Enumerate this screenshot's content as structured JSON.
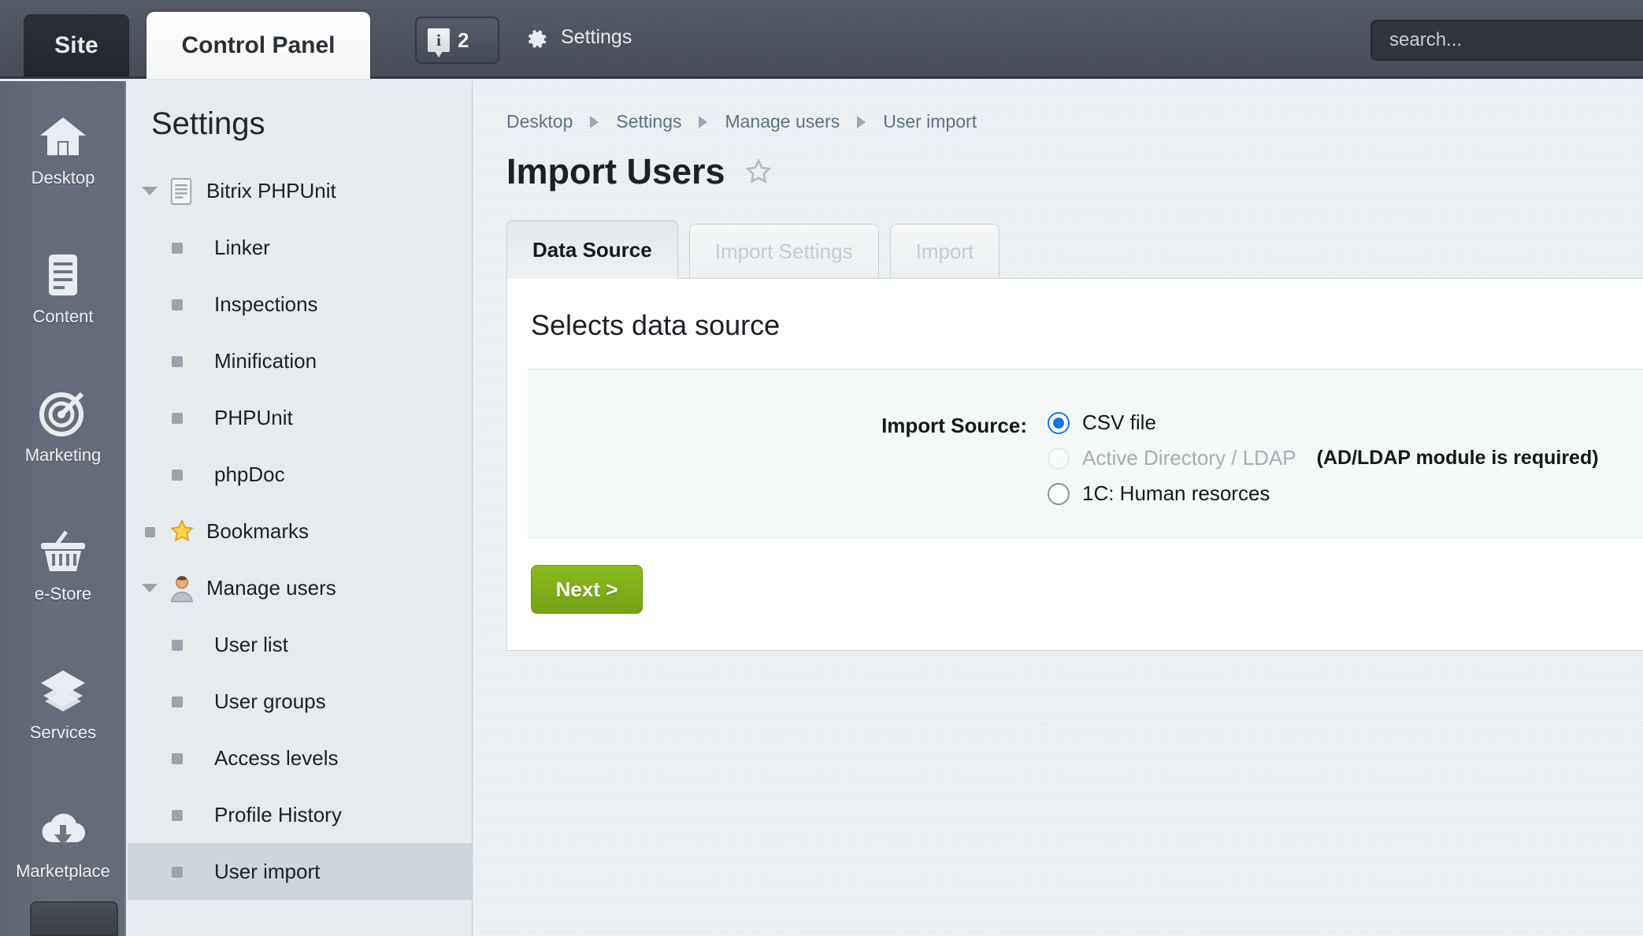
{
  "topbar": {
    "site_tab": "Site",
    "control_panel_tab": "Control Panel",
    "info_badge_count": "2",
    "info_badge_glyph": "i",
    "settings_link": "Settings",
    "search_placeholder": "search...",
    "search_value": ""
  },
  "sidebar": {
    "items": [
      {
        "label": "Desktop",
        "icon": "home-icon"
      },
      {
        "label": "Content",
        "icon": "document-icon"
      },
      {
        "label": "Marketing",
        "icon": "target-icon"
      },
      {
        "label": "e-Store",
        "icon": "basket-icon"
      },
      {
        "label": "Services",
        "icon": "layers-icon"
      },
      {
        "label": "Marketplace",
        "icon": "cloud-download-icon"
      }
    ]
  },
  "tree": {
    "title": "Settings",
    "items": [
      {
        "label": "Bitrix PHPUnit",
        "level": 1,
        "marker": "twisty-open",
        "icon": "page-icon",
        "selected": false
      },
      {
        "label": "Linker",
        "level": 2,
        "marker": "bullet",
        "icon": null,
        "selected": false
      },
      {
        "label": "Inspections",
        "level": 2,
        "marker": "bullet",
        "icon": null,
        "selected": false
      },
      {
        "label": "Minification",
        "level": 2,
        "marker": "bullet",
        "icon": null,
        "selected": false
      },
      {
        "label": "PHPUnit",
        "level": 2,
        "marker": "bullet",
        "icon": null,
        "selected": false
      },
      {
        "label": "phpDoc",
        "level": 2,
        "marker": "bullet",
        "icon": null,
        "selected": false
      },
      {
        "label": "Bookmarks",
        "level": 1,
        "marker": "square",
        "icon": "star-icon",
        "selected": false
      },
      {
        "label": "Manage users",
        "level": 1,
        "marker": "twisty-open",
        "icon": "user-icon",
        "selected": false
      },
      {
        "label": "User list",
        "level": 2,
        "marker": "bullet",
        "icon": null,
        "selected": false
      },
      {
        "label": "User groups",
        "level": 2,
        "marker": "bullet",
        "icon": null,
        "selected": false
      },
      {
        "label": "Access levels",
        "level": 2,
        "marker": "bullet",
        "icon": null,
        "selected": false
      },
      {
        "label": "Profile History",
        "level": 2,
        "marker": "bullet",
        "icon": null,
        "selected": false
      },
      {
        "label": "User import",
        "level": 2,
        "marker": "bullet",
        "icon": null,
        "selected": true
      }
    ]
  },
  "main": {
    "breadcrumb": [
      "Desktop",
      "Settings",
      "Manage users",
      "User import"
    ],
    "page_title": "Import Users",
    "tabs": [
      {
        "label": "Data Source",
        "active": true
      },
      {
        "label": "Import Settings",
        "active": false
      },
      {
        "label": "Import",
        "active": false
      }
    ],
    "panel_heading": "Selects data source",
    "field_label": "Import Source:",
    "radios": [
      {
        "label": "CSV file",
        "checked": true,
        "disabled": false,
        "note": ""
      },
      {
        "label": "Active Directory / LDAP",
        "checked": false,
        "disabled": true,
        "note": "(AD/LDAP module is required)"
      },
      {
        "label": "1C: Human resorces",
        "checked": false,
        "disabled": false,
        "note": ""
      }
    ],
    "next_button": "Next >"
  },
  "colors": {
    "topbar": "#4c525e",
    "sidebar": "#646b78",
    "accent_green": "#7ea91a",
    "radio_blue": "#1677dd",
    "link_blue": "#5d7186",
    "panel_bg": "#e8edf0"
  }
}
